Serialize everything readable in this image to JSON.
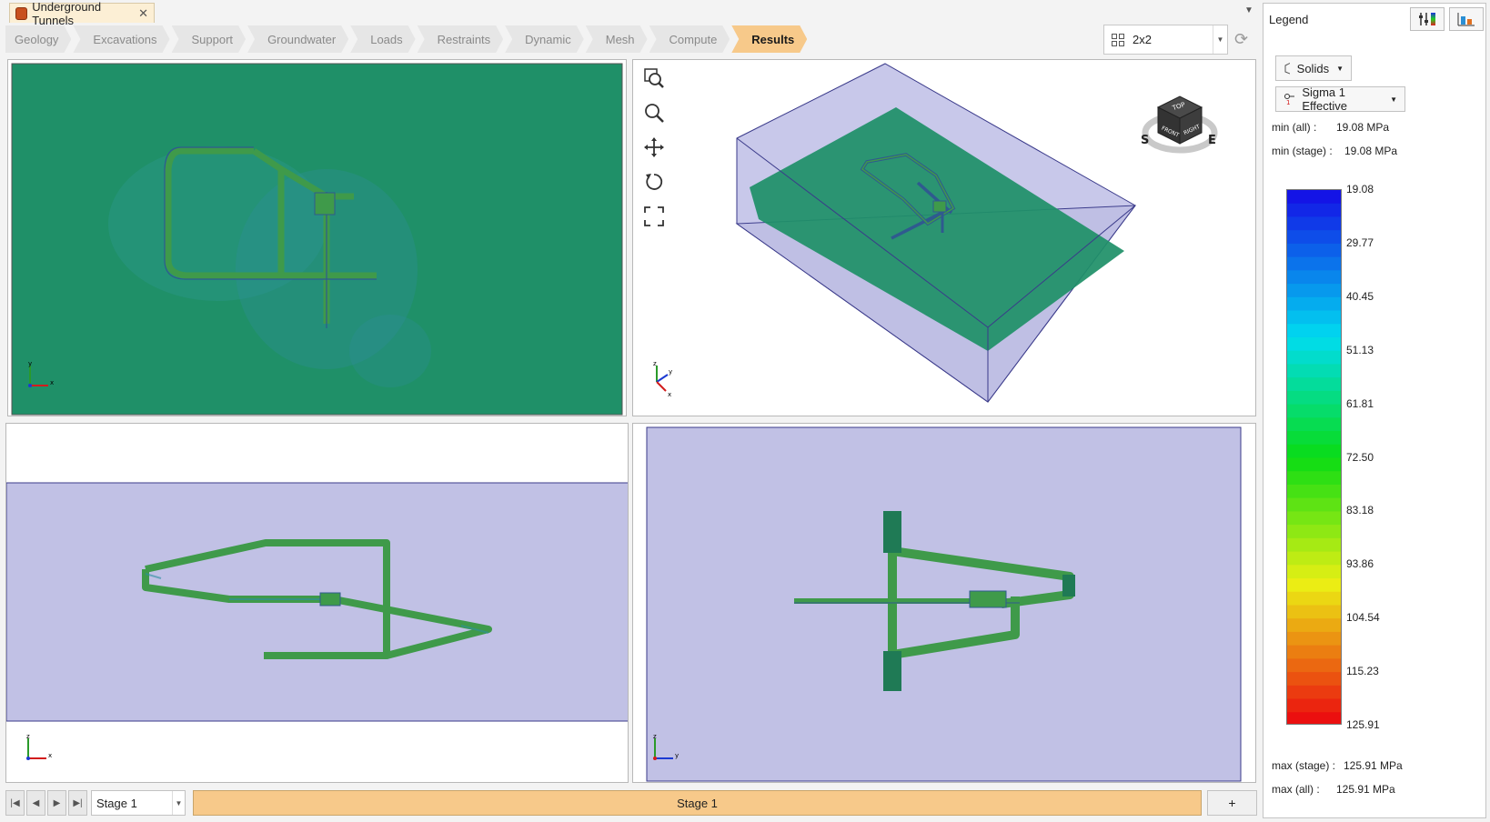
{
  "document_tab": {
    "title": "Underground Tunnels",
    "close": "✕"
  },
  "workflow_tabs": [
    {
      "label": "Geology",
      "active": false
    },
    {
      "label": "Excavations",
      "active": false
    },
    {
      "label": "Support",
      "active": false
    },
    {
      "label": "Groundwater",
      "active": false
    },
    {
      "label": "Loads",
      "active": false
    },
    {
      "label": "Restraints",
      "active": false
    },
    {
      "label": "Dynamic",
      "active": false
    },
    {
      "label": "Mesh",
      "active": false
    },
    {
      "label": "Compute",
      "active": false
    },
    {
      "label": "Results",
      "active": true
    }
  ],
  "layout_select": {
    "value": "2x2"
  },
  "tools": [
    "zoom-window-icon",
    "zoom-icon",
    "pan-icon",
    "rotate-icon",
    "zoom-extents-icon"
  ],
  "view_cube": {
    "top": "TOP",
    "front": "FRONT",
    "right": "RIGHT",
    "south": "S",
    "east": "E"
  },
  "stage_bar": {
    "stage_select": "Stage 1",
    "stage_strip": "Stage 1",
    "add_label": "+"
  },
  "legend": {
    "title": "Legend",
    "solids_label": "Solids",
    "result_label": "Sigma 1 Effective",
    "min_all_label": "min (all) :",
    "min_all_value": "19.08 MPa",
    "min_stage_label": "min (stage) :",
    "min_stage_value": "19.08 MPa",
    "max_stage_label": "max (stage) :",
    "max_stage_value": "125.91 MPa",
    "max_all_label": "max (all) :",
    "max_all_value": "125.91 MPa",
    "ticks": [
      "19.08",
      "29.77",
      "40.45",
      "51.13",
      "61.81",
      "72.50",
      "83.18",
      "93.86",
      "104.54",
      "115.23",
      "125.91"
    ]
  },
  "colors": {
    "active_tab": "#f7c98a",
    "model_green": "#1f9068",
    "box_fill": "#c1c1e5",
    "box_edge": "#3a3a8a"
  }
}
